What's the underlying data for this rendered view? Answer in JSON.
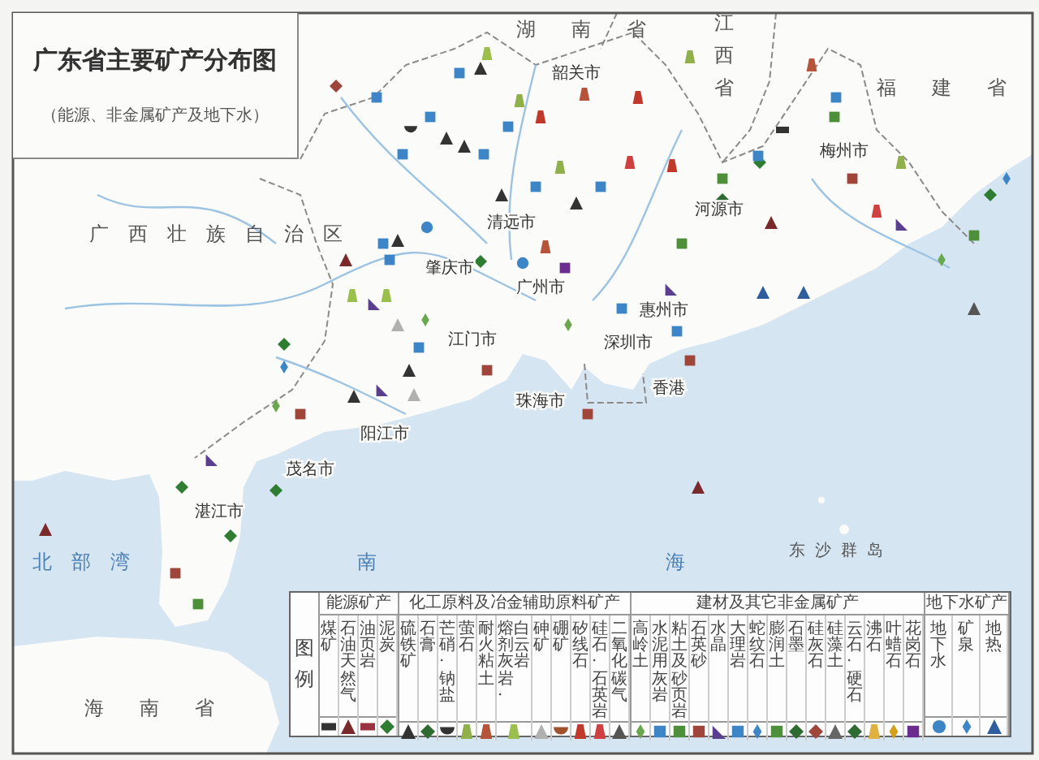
{
  "title": "广东省主要矿产分布图",
  "subtitle": "（能源、非金属矿产及地下水）",
  "labels": [
    {
      "kind": "province",
      "text": "湖南省"
    },
    {
      "kind": "vertical",
      "text": "江西省"
    },
    {
      "kind": "province",
      "text": "福建省"
    },
    {
      "kind": "province",
      "text": "广西壮族自治区"
    },
    {
      "kind": "city",
      "text": "韶关市"
    },
    {
      "kind": "city",
      "text": "梅州市"
    },
    {
      "kind": "city",
      "text": "清远市"
    },
    {
      "kind": "city",
      "text": "河源市"
    },
    {
      "kind": "city",
      "text": "肇庆市"
    },
    {
      "kind": "city",
      "text": "广州市"
    },
    {
      "kind": "city",
      "text": "惠州市"
    },
    {
      "kind": "city",
      "text": "江门市"
    },
    {
      "kind": "city",
      "text": "深圳市"
    },
    {
      "kind": "city",
      "text": "珠海市"
    },
    {
      "kind": "city",
      "text": "香港"
    },
    {
      "kind": "city",
      "text": "阳江市"
    },
    {
      "kind": "city",
      "text": "茂名市"
    },
    {
      "kind": "city",
      "text": "湛江市"
    },
    {
      "kind": "sea",
      "text": "北部湾"
    },
    {
      "kind": "sea",
      "text": "南海"
    },
    {
      "kind": "island",
      "text": "东沙群岛"
    },
    {
      "kind": "province",
      "text": "海南省"
    }
  ],
  "legend": {
    "title": "图例",
    "groups": [
      {
        "heading": "能源矿产",
        "items": [
          {
            "labels": [
              "煤矿"
            ],
            "kind": "bar",
            "color": "#333333"
          },
          {
            "labels": [
              "石油天然气"
            ],
            "kind": "triangle",
            "color": "#7a2a2a"
          },
          {
            "labels": [
              "油页岩"
            ],
            "kind": "bar",
            "color": "#9b3040"
          },
          {
            "labels": [
              "泥炭"
            ],
            "kind": "diamond",
            "color": "#2e7d32"
          }
        ]
      },
      {
        "heading": "化工原料及冶金辅助原料矿产",
        "items": [
          {
            "labels": [
              "硫铁矿"
            ],
            "kind": "triangle",
            "color": "#333333"
          },
          {
            "labels": [
              "石膏"
            ],
            "kind": "diamond",
            "color": "#2e6b30"
          },
          {
            "labels": [
              "芒硝·钠盐"
            ],
            "kind": "bowl",
            "color": "#333333"
          },
          {
            "labels": [
              "萤石"
            ],
            "kind": "bell",
            "color": "#8fb04a"
          },
          {
            "labels": [
              "耐火粘土"
            ],
            "kind": "bell",
            "color": "#b5543a"
          },
          {
            "labels": [
              "熔剂灰岩·",
              "白云岩"
            ],
            "kind": "bell",
            "color": "#9bbf4d"
          },
          {
            "labels": [
              "砷矿"
            ],
            "kind": "triangle",
            "color": "#b0b0b0"
          },
          {
            "labels": [
              "硼矿"
            ],
            "kind": "bowl",
            "color": "#a0522d"
          },
          {
            "labels": [
              "矽线石"
            ],
            "kind": "bell",
            "color": "#c0392b"
          },
          {
            "labels": [
              "硅石·石英岩"
            ],
            "kind": "bell",
            "color": "#d04040"
          },
          {
            "labels": [
              "二氧化碳气"
            ],
            "kind": "triangle",
            "color": "#555555"
          }
        ]
      },
      {
        "heading": "建材及其它非金属矿产",
        "items": [
          {
            "labels": [
              "高岭土"
            ],
            "kind": "spindle",
            "color": "#6aa84f"
          },
          {
            "labels": [
              "水泥用灰岩"
            ],
            "kind": "square",
            "color": "#3d85c6"
          },
          {
            "labels": [
              "粘土及砂页岩"
            ],
            "kind": "square",
            "color": "#4d8f3a"
          },
          {
            "labels": [
              "石英砂"
            ],
            "kind": "square",
            "color": "#a0453a"
          },
          {
            "labels": [
              "水晶"
            ],
            "kind": "wedge",
            "color": "#5b3f8f"
          },
          {
            "labels": [
              "大理岩"
            ],
            "kind": "square",
            "color": "#3d85c6"
          },
          {
            "labels": [
              "蛇纹石"
            ],
            "kind": "spindle",
            "color": "#3d85c6"
          },
          {
            "labels": [
              "膨润土"
            ],
            "kind": "square",
            "color": "#4d8f3a"
          },
          {
            "labels": [
              "石墨"
            ],
            "kind": "diamond",
            "color": "#2e6b30"
          },
          {
            "labels": [
              "硅灰石"
            ],
            "kind": "diamond",
            "color": "#a0453a"
          },
          {
            "labels": [
              "硅藻土"
            ],
            "kind": "triangle",
            "color": "#666666"
          },
          {
            "labels": [
              "云石·硬石"
            ],
            "kind": "diamond",
            "color": "#2e6b30"
          },
          {
            "labels": [
              "沸石"
            ],
            "kind": "bell",
            "color": "#e0b040"
          },
          {
            "labels": [
              "叶蜡石"
            ],
            "kind": "spindle",
            "color": "#d4a017"
          },
          {
            "labels": [
              "花岗石"
            ],
            "kind": "square",
            "color": "#6a2c8f"
          }
        ]
      },
      {
        "heading": "地下水矿产",
        "items": [
          {
            "labels": [
              "地下水"
            ],
            "kind": "circle",
            "color": "#3d85c6"
          },
          {
            "labels": [
              "矿泉"
            ],
            "kind": "spindle",
            "color": "#3d85c6"
          },
          {
            "labels": [
              "地热"
            ],
            "kind": "triangle",
            "color": "#2e5e9e"
          }
        ]
      }
    ]
  }
}
